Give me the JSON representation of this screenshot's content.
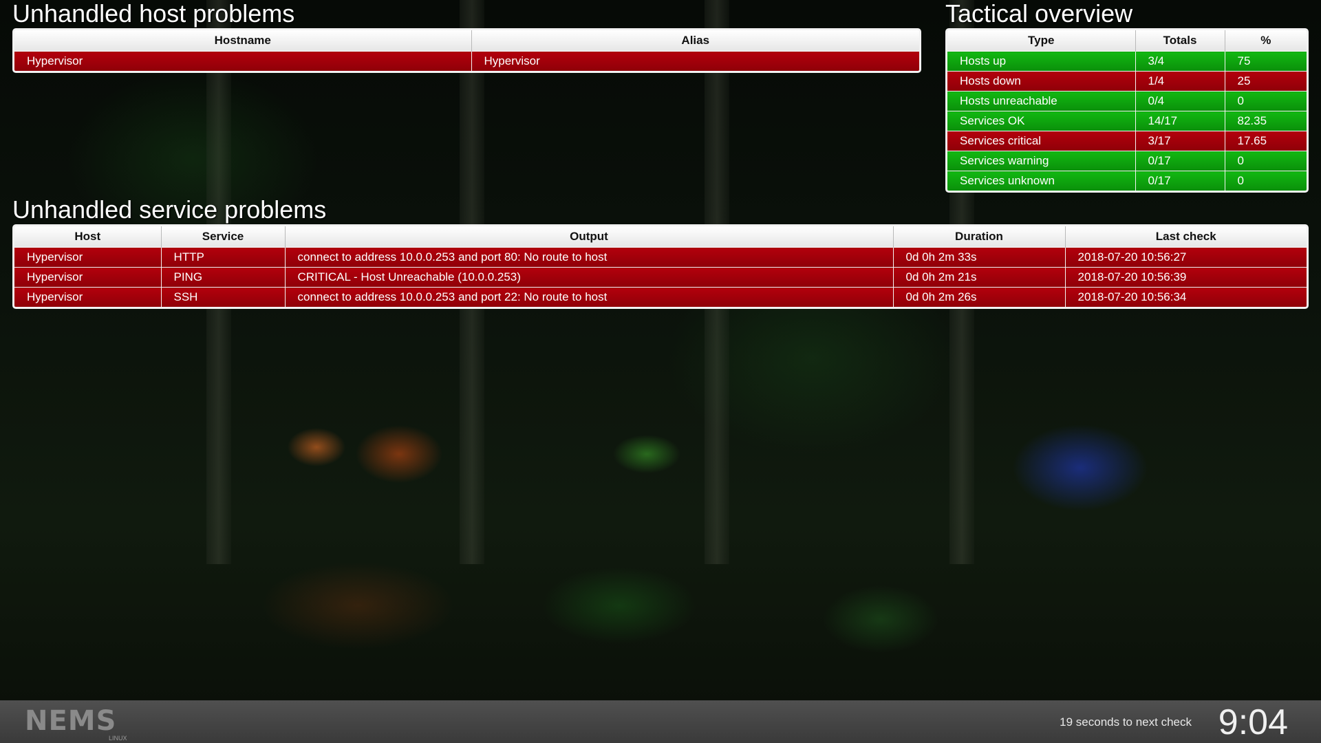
{
  "host_problems": {
    "title": "Unhandled host problems",
    "columns": [
      "Hostname",
      "Alias"
    ],
    "rows": [
      {
        "hostname": "Hypervisor",
        "alias": "Hypervisor",
        "state": "critical"
      }
    ]
  },
  "tactical": {
    "title": "Tactical overview",
    "columns": [
      "Type",
      "Totals",
      "%"
    ],
    "rows": [
      {
        "type": "Hosts up",
        "totals": "3/4",
        "percent": "75",
        "state": "ok"
      },
      {
        "type": "Hosts down",
        "totals": "1/4",
        "percent": "25",
        "state": "critical"
      },
      {
        "type": "Hosts unreachable",
        "totals": "0/4",
        "percent": "0",
        "state": "ok"
      },
      {
        "type": "Services OK",
        "totals": "14/17",
        "percent": "82.35",
        "state": "ok"
      },
      {
        "type": "Services critical",
        "totals": "3/17",
        "percent": "17.65",
        "state": "critical"
      },
      {
        "type": "Services warning",
        "totals": "0/17",
        "percent": "0",
        "state": "ok"
      },
      {
        "type": "Services unknown",
        "totals": "0/17",
        "percent": "0",
        "state": "ok"
      }
    ]
  },
  "service_problems": {
    "title": "Unhandled service problems",
    "columns": [
      "Host",
      "Service",
      "Output",
      "Duration",
      "Last check"
    ],
    "rows": [
      {
        "host": "Hypervisor",
        "service": "HTTP",
        "output": "connect to address 10.0.0.253 and port 80: No route to host",
        "duration": "0d 0h 2m 33s",
        "last_check": "2018-07-20 10:56:27",
        "state": "critical"
      },
      {
        "host": "Hypervisor",
        "service": "PING",
        "output": "CRITICAL - Host Unreachable (10.0.0.253)",
        "duration": "0d 0h 2m 21s",
        "last_check": "2018-07-20 10:56:39",
        "state": "critical"
      },
      {
        "host": "Hypervisor",
        "service": "SSH",
        "output": "connect to address 10.0.0.253 and port 22: No route to host",
        "duration": "0d 0h 2m 26s",
        "last_check": "2018-07-20 10:56:34",
        "state": "critical"
      }
    ]
  },
  "footer": {
    "logo_text": "NEMS",
    "logo_subtext": "LINUX",
    "countdown": "19 seconds to next check",
    "clock": "9:04"
  },
  "colors": {
    "critical": "#a0000a",
    "ok": "#10a810",
    "accent_logo": "#7cc242"
  }
}
